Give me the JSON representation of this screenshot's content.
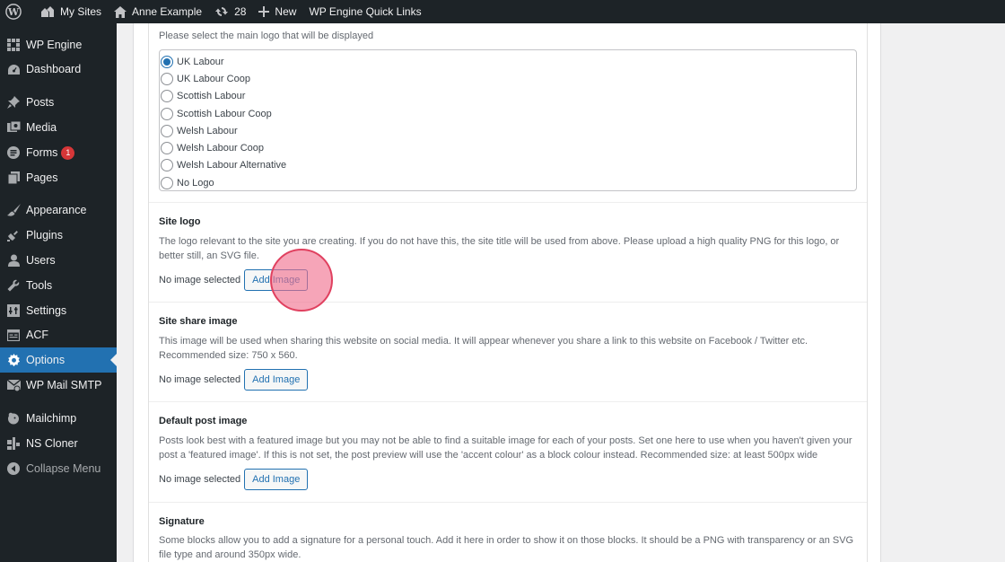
{
  "admin_bar": {
    "my_sites": "My Sites",
    "site_name": "Anne Example",
    "updates_count": "28",
    "new_label": "New",
    "quick_links": "WP Engine Quick Links"
  },
  "sidebar": {
    "items": [
      {
        "label": "WP Engine",
        "icon": "grid-icon"
      },
      {
        "label": "Dashboard",
        "icon": "dashboard-icon"
      },
      {
        "label": "Posts",
        "icon": "pin-icon"
      },
      {
        "label": "Media",
        "icon": "media-icon"
      },
      {
        "label": "Forms",
        "icon": "forms-icon",
        "badge": "1"
      },
      {
        "label": "Pages",
        "icon": "pages-icon"
      },
      {
        "label": "Appearance",
        "icon": "brush-icon"
      },
      {
        "label": "Plugins",
        "icon": "plug-icon"
      },
      {
        "label": "Users",
        "icon": "user-icon"
      },
      {
        "label": "Tools",
        "icon": "wrench-icon"
      },
      {
        "label": "Settings",
        "icon": "settings-icon"
      },
      {
        "label": "ACF",
        "icon": "acf-icon"
      },
      {
        "label": "Options",
        "icon": "gear-icon",
        "active": true
      },
      {
        "label": "WP Mail SMTP",
        "icon": "mail-icon"
      },
      {
        "label": "Mailchimp",
        "icon": "mailchimp-icon"
      },
      {
        "label": "NS Cloner",
        "icon": "cloner-icon"
      },
      {
        "label": "Collapse Menu",
        "icon": "collapse-icon"
      }
    ]
  },
  "main_logo": {
    "description": "Please select the main logo that will be displayed",
    "options": [
      "UK Labour",
      "UK Labour Coop",
      "Scottish Labour",
      "Scottish Labour Coop",
      "Welsh Labour",
      "Welsh Labour Coop",
      "Welsh Labour Alternative",
      "No Logo"
    ],
    "selected": "UK Labour"
  },
  "site_logo": {
    "label": "Site logo",
    "description": "The logo relevant to the site you are creating. If you do not have this, the site title will be used from above. Please upload a high quality PNG for this logo, or better still, an SVG file.",
    "no_image": "No image selected",
    "button": "Add Image"
  },
  "site_share_image": {
    "label": "Site share image",
    "description": "This image will be used when sharing this website on social media. It will appear whenever you share a link to this website on Facebook / Twitter etc. Recommended size: 750 x 560.",
    "no_image": "No image selected",
    "button": "Add Image"
  },
  "default_post_image": {
    "label": "Default post image",
    "description": "Posts look best with a featured image but you may not be able to find a suitable image for each of your posts. Set one here to use when you haven't given your post a 'featured image'. If this is not set, the post preview will use the 'accent colour' as a block colour instead. Recommended size: at least 500px wide",
    "no_image": "No image selected",
    "button": "Add Image"
  },
  "signature": {
    "label": "Signature",
    "description": "Some blocks allow you to add a signature for a personal touch. Add it here in order to show it on those blocks. It should be a PNG with transparency or an SVG file type and around 350px wide."
  },
  "colors": {
    "accent": "#2271b1",
    "admin_bg": "#1d2327",
    "badge": "#d63638"
  }
}
